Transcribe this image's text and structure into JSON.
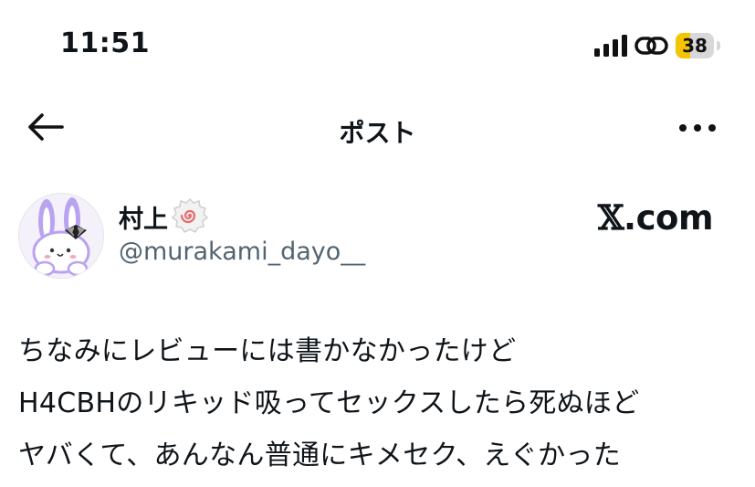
{
  "status_bar": {
    "time": "11:51",
    "battery_level": "38",
    "battery_fraction": 0.38,
    "icons": [
      "signal-bars-icon",
      "link-icon",
      "battery-icon"
    ]
  },
  "header": {
    "title": "ポスト",
    "back_icon": "arrow-left-icon",
    "more_icon": "more-horizontal-icon"
  },
  "post": {
    "author": {
      "name": "村上",
      "handle": "@murakami_dayo__",
      "avatar_icon": "bunny-avatar",
      "badge_icon": "naruto-swirl-badge"
    },
    "watermark": {
      "x": "𝕏",
      "domain": ".com"
    },
    "body_lines": [
      "ちなみにレビューには書かなかったけど",
      "H4CBHのリキッド吸ってセックスしたら死ぬほど",
      "ヤバくて、あんなん普通にキメセク、えぐかった"
    ]
  },
  "colors": {
    "text": "#0f1419",
    "secondary": "#536471",
    "battery_fill": "#f5c400",
    "avatar_purple": "#b9a3f0"
  }
}
